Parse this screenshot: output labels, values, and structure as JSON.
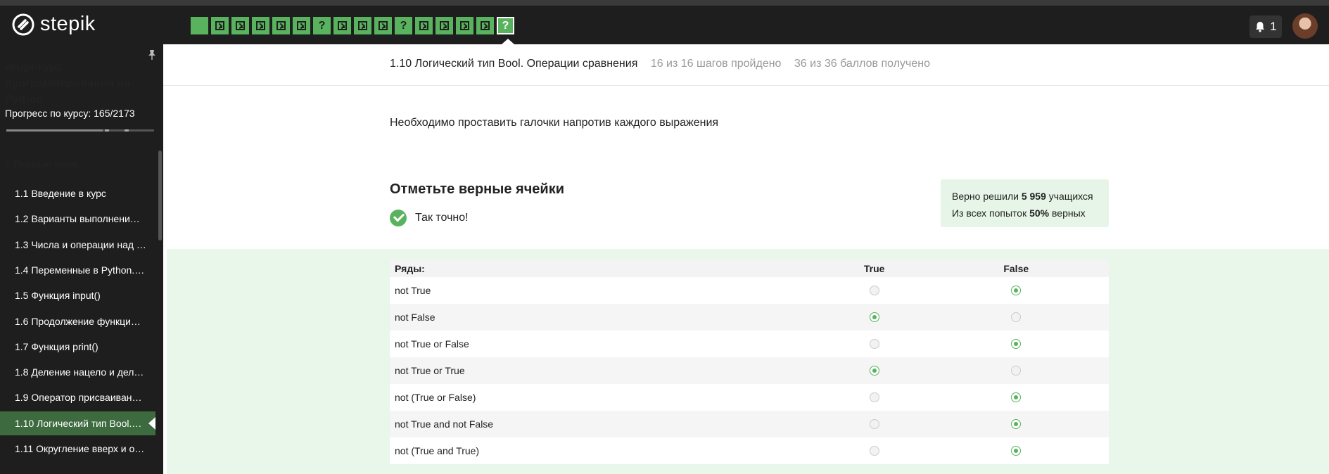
{
  "header": {
    "logo_text": "stepik",
    "steps": [
      {
        "icon": "solid-step-icon",
        "text": ""
      },
      {
        "icon": "terminal-icon",
        "text": ""
      },
      {
        "icon": "terminal-icon",
        "text": ""
      },
      {
        "icon": "terminal-icon",
        "text": ""
      },
      {
        "icon": "terminal-icon",
        "text": ""
      },
      {
        "icon": "terminal-icon",
        "text": ""
      },
      {
        "icon": "question-icon",
        "text": "?"
      },
      {
        "icon": "terminal-icon",
        "text": ""
      },
      {
        "icon": "terminal-icon",
        "text": ""
      },
      {
        "icon": "terminal-icon",
        "text": ""
      },
      {
        "icon": "question-icon",
        "text": "?"
      },
      {
        "icon": "terminal-icon",
        "text": ""
      },
      {
        "icon": "terminal-icon",
        "text": ""
      },
      {
        "icon": "terminal-icon",
        "text": ""
      },
      {
        "icon": "terminal-icon",
        "text": ""
      },
      {
        "icon": "question-icon",
        "text": "?",
        "active": true
      }
    ],
    "notifications_count": "1",
    "colors": {
      "accent": "#59b35e",
      "topbar": "#1e1e1e"
    }
  },
  "sidebar": {
    "course_title": "Инди-курс программирования на Python",
    "progress_label": "Прогресс по курсу:  165/2173",
    "section_title": "1  Первые шаги",
    "lessons": [
      "1.1  Введение в курс",
      "1.2  Варианты выполнени…",
      "1.3  Числа и операции над …",
      "1.4  Переменные в Python.…",
      "1.5  Функция input()",
      "1.6  Продолжение функци…",
      "1.7  Функция print()",
      "1.8  Деление нацело и дел…",
      "1.9  Оператор присваиван…",
      "1.10  Логический тип Bool.…",
      "1.11  Округление вверх и о…"
    ],
    "active_lesson_index": 9
  },
  "main": {
    "lesson_title": "1.10 Логический тип Bool. Операции сравнения",
    "steps_done": "16 из 16 шагов пройдено",
    "points": "36 из 36 баллов  получено",
    "instruction": "Необходимо проставить галочки напротив каждого выражения",
    "task_title": "Отметьте верные ячейки",
    "result_text": "Так точно!",
    "stats": {
      "line1_prefix": "Верно решили ",
      "line1_value": "5 959",
      "line1_suffix": " учащихся",
      "line2_prefix": "Из всех попыток ",
      "line2_value": "50%",
      "line2_suffix": " верных"
    },
    "table": {
      "headers": [
        "Ряды:",
        "True",
        "False"
      ],
      "rows": [
        {
          "label": "not True",
          "true": false,
          "false": true
        },
        {
          "label": "not False",
          "true": true,
          "false": false
        },
        {
          "label": "not True or False",
          "true": false,
          "false": true
        },
        {
          "label": "not True or True",
          "true": true,
          "false": false
        },
        {
          "label": "not (True or False)",
          "true": false,
          "false": true
        },
        {
          "label": "not True and not False",
          "true": false,
          "false": true
        },
        {
          "label": "not (True and True)",
          "true": false,
          "false": true
        }
      ]
    }
  }
}
